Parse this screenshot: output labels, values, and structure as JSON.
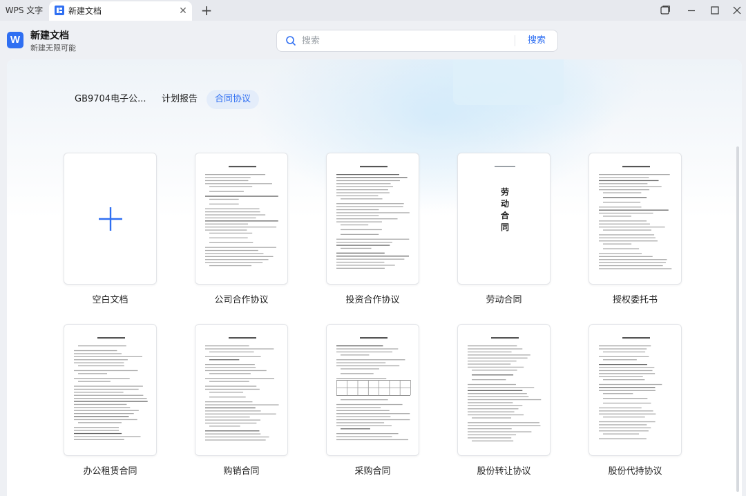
{
  "titlebar": {
    "app_tab_label": "WPS 文字",
    "doc_tab_label": "新建文档",
    "close_glyph": "✕",
    "add_glyph": "+",
    "window_controls": [
      "restore-windows-icon",
      "minimize-icon",
      "maximize-icon",
      "close-icon"
    ]
  },
  "header": {
    "logo_letter": "W",
    "title": "新建文档",
    "subtitle": "新建无限可能",
    "search_placeholder": "搜索",
    "search_button": "搜索"
  },
  "category_tabs": [
    {
      "label": "GB9704电子公...",
      "active": false
    },
    {
      "label": "计划报告",
      "active": false
    },
    {
      "label": "合同协议",
      "active": true
    }
  ],
  "templates": [
    {
      "label": "空白文档",
      "kind": "blank"
    },
    {
      "label": "公司合作协议",
      "kind": "doc"
    },
    {
      "label": "投资合作协议",
      "kind": "doc"
    },
    {
      "label": "劳动合同",
      "kind": "vertical",
      "cover_title": "劳动合同"
    },
    {
      "label": "授权委托书",
      "kind": "doc"
    },
    {
      "label": "办公租赁合同",
      "kind": "doc"
    },
    {
      "label": "购销合同",
      "kind": "doc"
    },
    {
      "label": "采购合同",
      "kind": "doc"
    },
    {
      "label": "股份转让协议",
      "kind": "doc"
    },
    {
      "label": "股份代持协议",
      "kind": "doc"
    }
  ],
  "colors": {
    "accent": "#2f6ff2",
    "active_tab_bg": "#e4edfa"
  }
}
